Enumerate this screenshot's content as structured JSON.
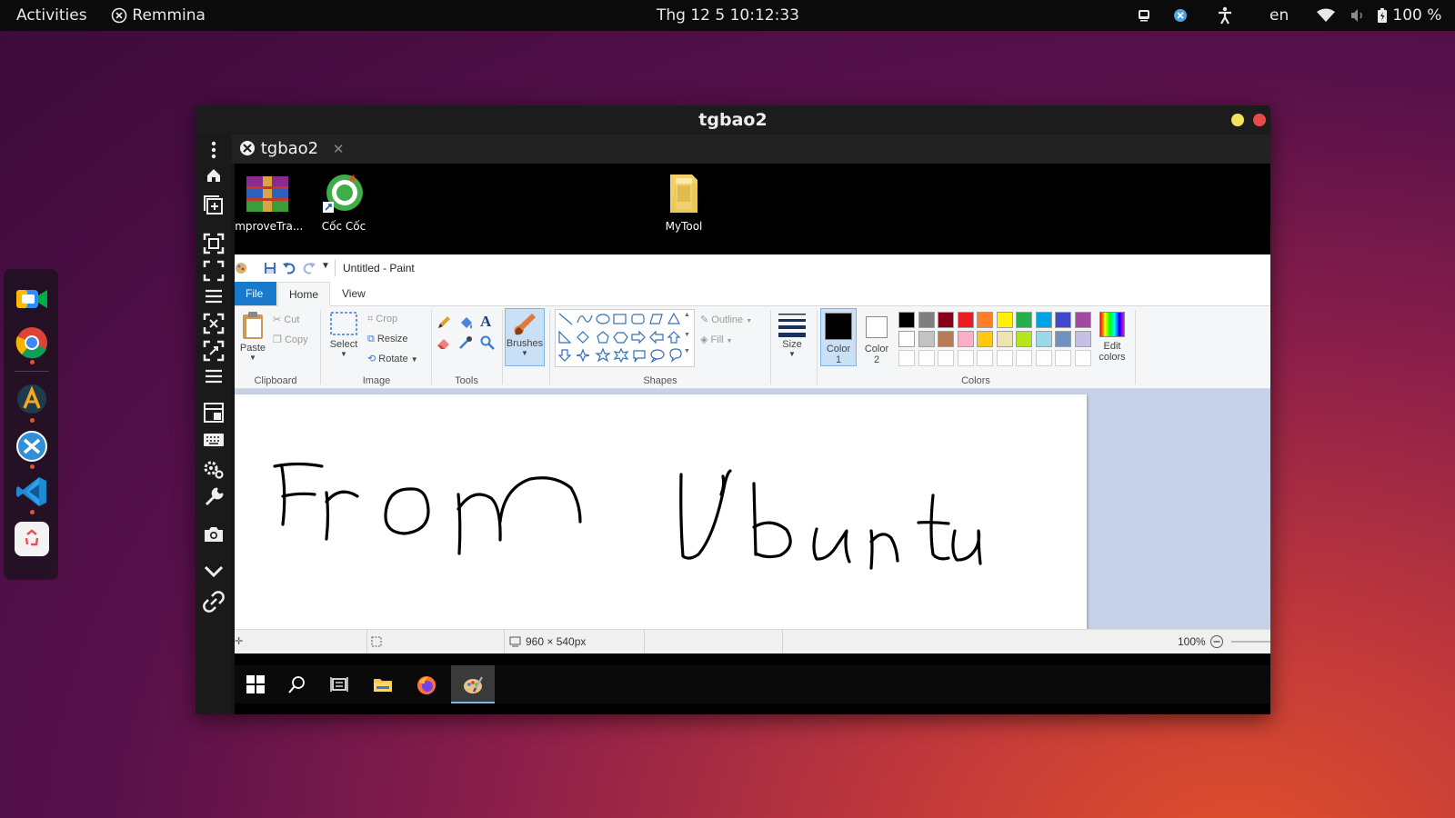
{
  "topbar": {
    "activities": "Activities",
    "app_name": "Remmina",
    "datetime": "Thg 12 5  10:12:33",
    "language": "en",
    "battery": "100 %"
  },
  "dock": {
    "apps": [
      "zoom",
      "chrome",
      "arduino",
      "remmina",
      "vscode",
      "trash"
    ]
  },
  "window": {
    "title": "tgbao2",
    "tab_label": "tgbao2"
  },
  "remote_desktop": {
    "icons": [
      {
        "label": "ImproveTra..."
      },
      {
        "label": "Cốc Cốc"
      },
      {
        "label": "MyTool"
      }
    ]
  },
  "paint": {
    "title": "Untitled - Paint",
    "tabs": {
      "file": "File",
      "home": "Home",
      "view": "View"
    },
    "clipboard": {
      "paste": "Paste",
      "cut": "Cut",
      "copy": "Copy",
      "group": "Clipboard"
    },
    "image": {
      "select": "Select",
      "crop": "Crop",
      "resize": "Resize",
      "rotate": "Rotate",
      "group": "Image"
    },
    "tools": {
      "group": "Tools"
    },
    "brushes": "Brushes",
    "shapes": {
      "outline": "Outline",
      "fill": "Fill",
      "group": "Shapes"
    },
    "size": "Size",
    "color1": {
      "line1": "Color",
      "line2": "1"
    },
    "color2": {
      "line1": "Color",
      "line2": "2"
    },
    "colors_group": "Colors",
    "edit_colors": {
      "line1": "Edit",
      "line2": "colors"
    },
    "palette_row1": [
      "#000000",
      "#7f7f7f",
      "#880015",
      "#ed1c24",
      "#ff7f27",
      "#fff200",
      "#22b14c",
      "#00a2e8",
      "#3f48cc",
      "#a349a4"
    ],
    "palette_row2": [
      "#ffffff",
      "#c3c3c3",
      "#b97a57",
      "#ffaec9",
      "#ffc90e",
      "#efe4b0",
      "#b5e61d",
      "#99d9ea",
      "#7092be",
      "#c8bfe7"
    ],
    "canvas_size": "960 × 540px",
    "zoom": "100%"
  }
}
